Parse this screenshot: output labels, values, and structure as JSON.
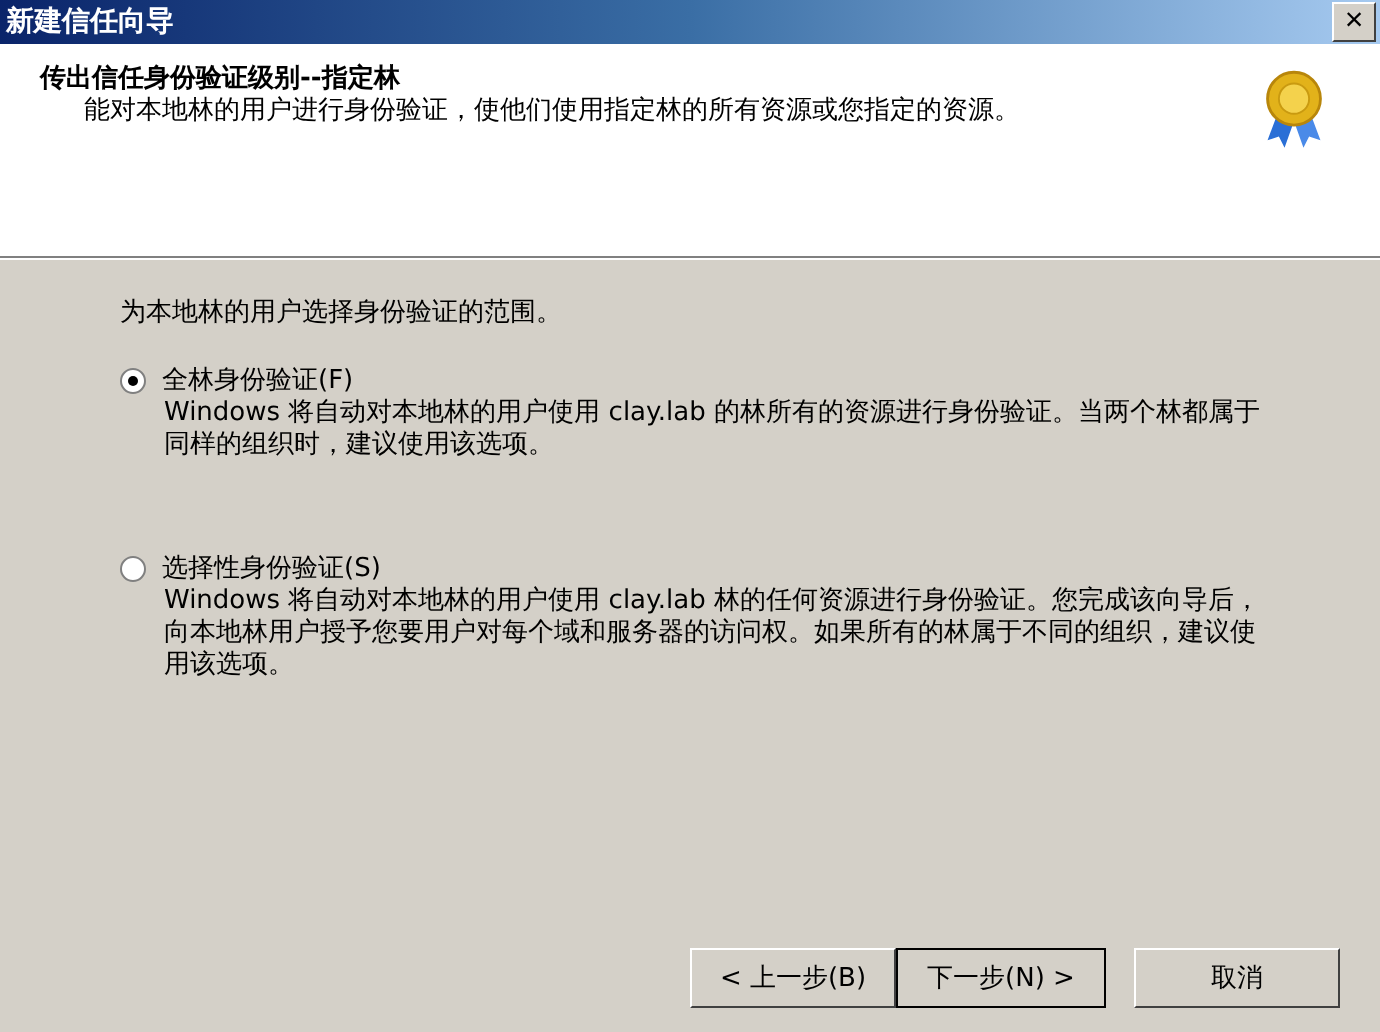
{
  "window": {
    "title": "新建信任向导",
    "close": "×"
  },
  "header": {
    "title": "传出信任身份验证级别--指定林",
    "description": "能对本地林的用户进行身份验证，使他们使用指定林的所有资源或您指定的资源。"
  },
  "prompt": "为本地林的用户选择身份验证的范围。",
  "options": [
    {
      "label": "全林身份验证(F)",
      "selected": true,
      "description": "Windows 将自动对本地林的用户使用 clay.lab 的林所有的资源进行身份验证。当两个林都属于同样的组织时，建议使用该选项。"
    },
    {
      "label": "选择性身份验证(S)",
      "selected": false,
      "description": "Windows 将自动对本地林的用户使用 clay.lab 林的任何资源进行身份验证。您完成该向导后，向本地林用户授予您要用户对每个域和服务器的访问权。如果所有的林属于不同的组织，建议使用该选项。"
    }
  ],
  "buttons": [
    {
      "label": "< 上一步(B)",
      "default": false
    },
    {
      "label": "下一步(N) >",
      "default": true
    },
    {
      "label": "取消",
      "default": false
    }
  ]
}
